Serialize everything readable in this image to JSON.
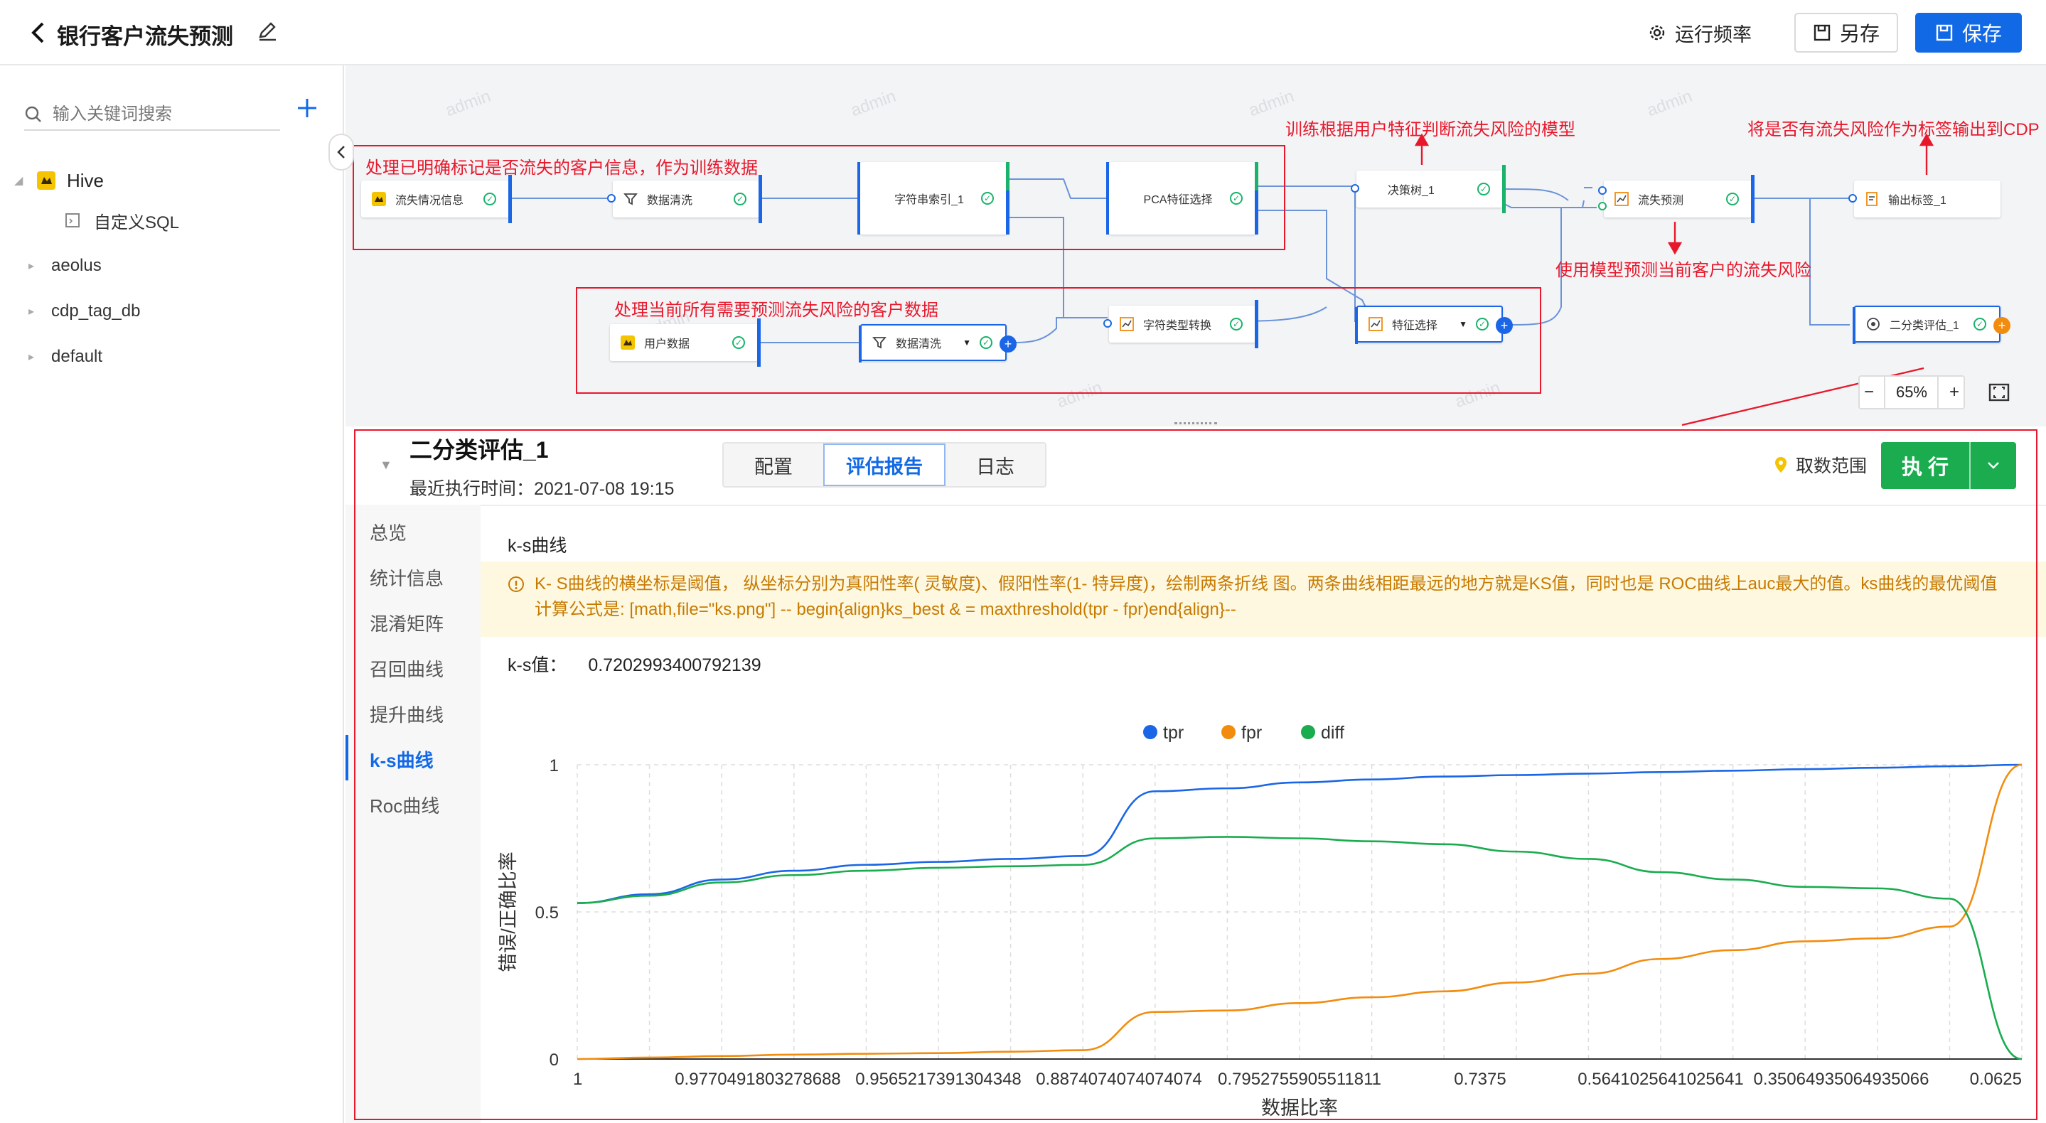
{
  "header": {
    "title": "银行客户流失预测",
    "run_freq": "运行频率",
    "save_as": "另存",
    "save": "保存"
  },
  "sidebar": {
    "search_placeholder": "输入关键词搜索",
    "tree": [
      {
        "label": "Hive"
      },
      {
        "label": "自定义SQL"
      },
      {
        "label": "aeolus"
      },
      {
        "label": "cdp_tag_db"
      },
      {
        "label": "default"
      }
    ]
  },
  "canvas": {
    "watermark": "admin",
    "zoom": "65%",
    "nodes": [
      {
        "label": "流失情况信息"
      },
      {
        "label": "数据清洗"
      },
      {
        "label": "字符串索引_1"
      },
      {
        "label": "PCA特征选择"
      },
      {
        "label": "决策树_1"
      },
      {
        "label": "流失预测"
      },
      {
        "label": "输出标签_1"
      },
      {
        "label": "用户数据"
      },
      {
        "label": "数据清洗"
      },
      {
        "label": "字符类型转换"
      },
      {
        "label": "特征选择"
      },
      {
        "label": "二分类评估_1"
      }
    ],
    "annotations": [
      "处理已明确标记是否流失的客户信息，作为训练数据",
      "处理当前所有需要预测流失风险的客户数据",
      "训练根据用户特征判断流失风险的模型",
      "将是否有流失风险作为标签输出到CDP",
      "使用模型预测当前客户的流失风险"
    ]
  },
  "panel": {
    "title": "二分类评估_1",
    "last_run": "最近执行时间：2021-07-08 19:15",
    "tabs": [
      {
        "label": "配置"
      },
      {
        "label": "评估报告"
      },
      {
        "label": "日志"
      }
    ],
    "range": "取数范围",
    "exec": "执 行",
    "nav": [
      {
        "label": "总览"
      },
      {
        "label": "统计信息"
      },
      {
        "label": "混淆矩阵"
      },
      {
        "label": "召回曲线"
      },
      {
        "label": "提升曲线"
      },
      {
        "label": "k-s曲线"
      },
      {
        "label": "Roc曲线"
      }
    ],
    "section_title": "k-s曲线",
    "notice_line1": "K- S曲线的横坐标是阈值，  纵坐标分别为真阳性率( 灵敏度)、假阳性率(1- 特异度)，绘制两条折线 图。两条曲线相距最远的地方就是KS值，同时也是 ROC曲线上auc最大的值。ks曲线的最优阈值",
    "notice_line2": "计算公式是: [math,file=\"ks.png\"] -- begin{align}ks_best & = maxthreshold(tpr - fpr)end{align}--",
    "ks_label": "k-s值：",
    "ks_value": "0.7202993400792139"
  },
  "chart_data": {
    "type": "line",
    "xlabel": "数据比率",
    "ylabel": "错误/正确比率",
    "x_tick_labels": [
      "1",
      "0.9770491803278688",
      "0.9565217391304348",
      "0.8874074074074074",
      "0.7952755905511811",
      "0.7375",
      "0.5641025641025641",
      "0.35064935064935066",
      "0.0625"
    ],
    "y_ticks": [
      0,
      0.5,
      1
    ],
    "ylim": [
      0,
      1
    ],
    "grid": true,
    "legend_position": "top",
    "x_points": 21,
    "series": [
      {
        "name": "tpr",
        "color": "#1a66e6",
        "values": [
          0.53,
          0.56,
          0.61,
          0.64,
          0.66,
          0.67,
          0.68,
          0.69,
          0.91,
          0.92,
          0.94,
          0.95,
          0.96,
          0.965,
          0.97,
          0.975,
          0.98,
          0.985,
          0.99,
          0.995,
          1.0
        ]
      },
      {
        "name": "fpr",
        "color": "#f28c0f",
        "values": [
          0.0,
          0.005,
          0.01,
          0.015,
          0.018,
          0.02,
          0.025,
          0.03,
          0.16,
          0.165,
          0.19,
          0.21,
          0.23,
          0.26,
          0.29,
          0.34,
          0.37,
          0.4,
          0.41,
          0.45,
          1.0
        ]
      },
      {
        "name": "diff",
        "color": "#1aac4e",
        "values": [
          0.53,
          0.555,
          0.6,
          0.625,
          0.64,
          0.65,
          0.655,
          0.66,
          0.75,
          0.755,
          0.75,
          0.74,
          0.73,
          0.705,
          0.68,
          0.635,
          0.61,
          0.585,
          0.58,
          0.545,
          0.0
        ]
      }
    ]
  }
}
